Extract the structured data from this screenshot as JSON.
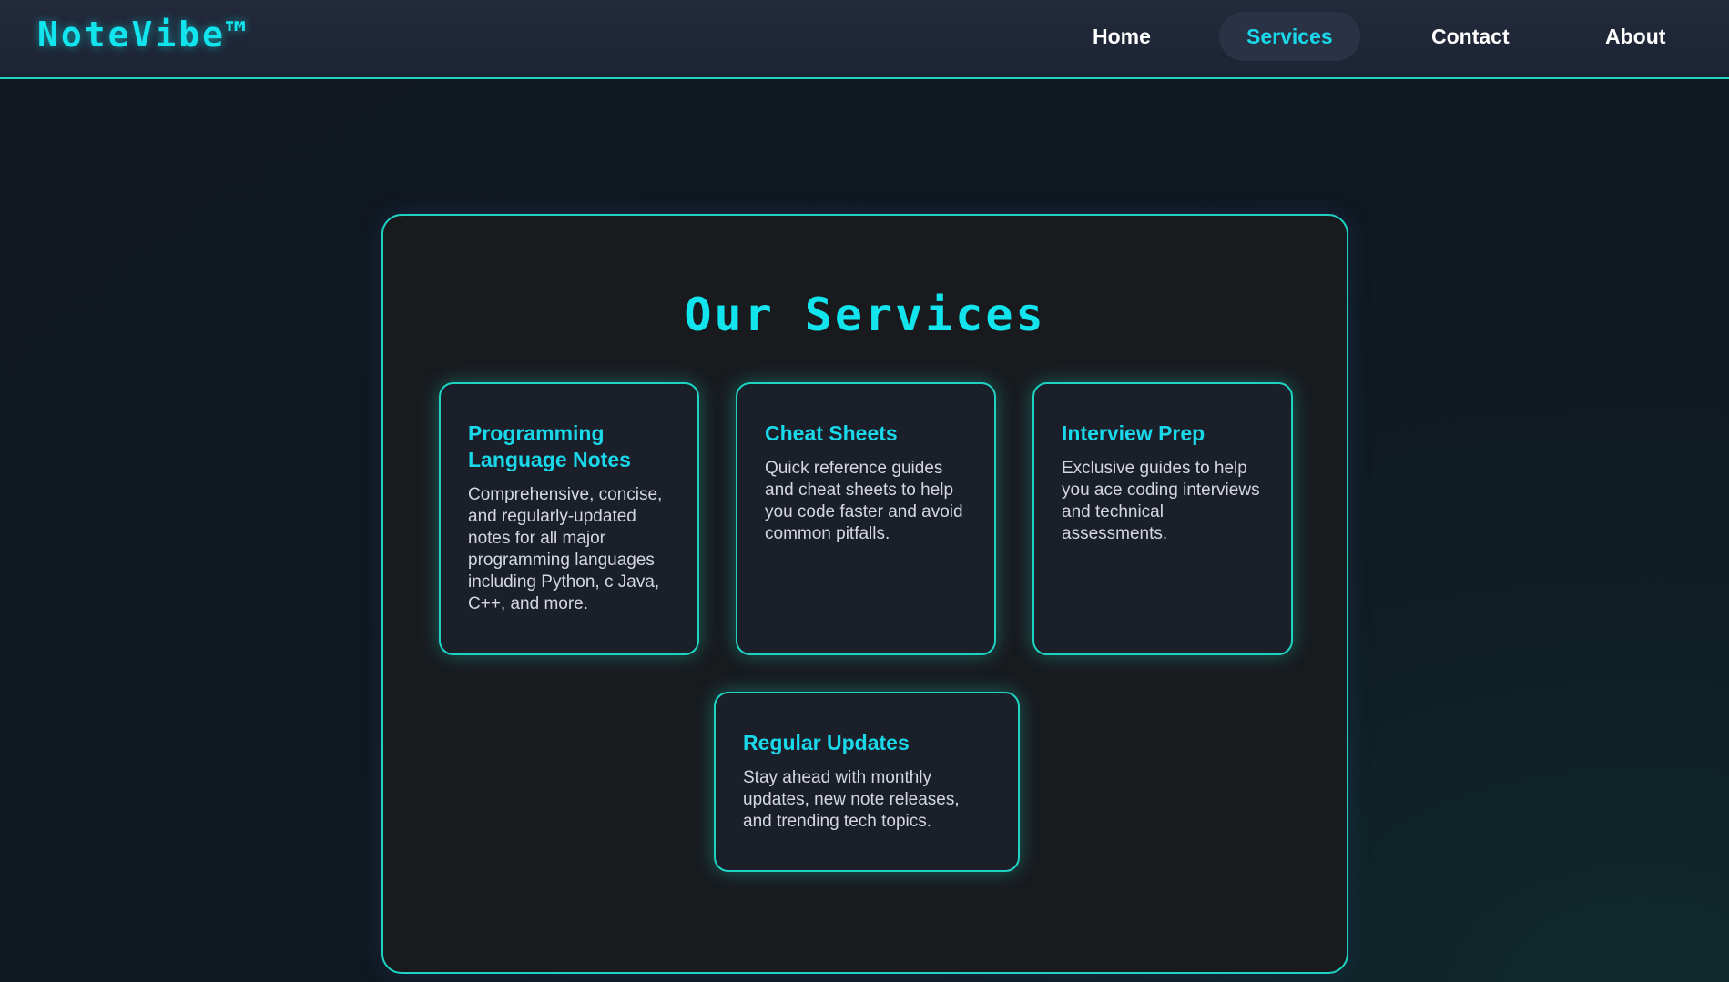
{
  "header": {
    "logo": "NoteVibe™",
    "nav": [
      {
        "label": "Home",
        "active": false
      },
      {
        "label": "Services",
        "active": true
      },
      {
        "label": "Contact",
        "active": false
      },
      {
        "label": "About",
        "active": false
      }
    ]
  },
  "main": {
    "title": "Our Services",
    "cards": [
      {
        "title": "Programming Language Notes",
        "text": "Comprehensive, concise, and regularly-updated notes for all major programming languages including Python, c Java, C++, and more."
      },
      {
        "title": "Cheat Sheets",
        "text": "Quick reference guides and cheat sheets to help you code faster and avoid common pitfalls."
      },
      {
        "title": "Interview Prep",
        "text": "Exclusive guides to help you ace coding interviews and technical assessments."
      },
      {
        "title": "Regular Updates",
        "text": "Stay ahead with monthly updates, new note releases, and trending tech topics."
      }
    ]
  },
  "colors": {
    "accent": "#12e4ee",
    "border": "#1fd3c3",
    "nav_background": "#1f2637",
    "page_background": "#111820",
    "panel_background": "#181a1e",
    "card_background": "#1b1f29"
  }
}
